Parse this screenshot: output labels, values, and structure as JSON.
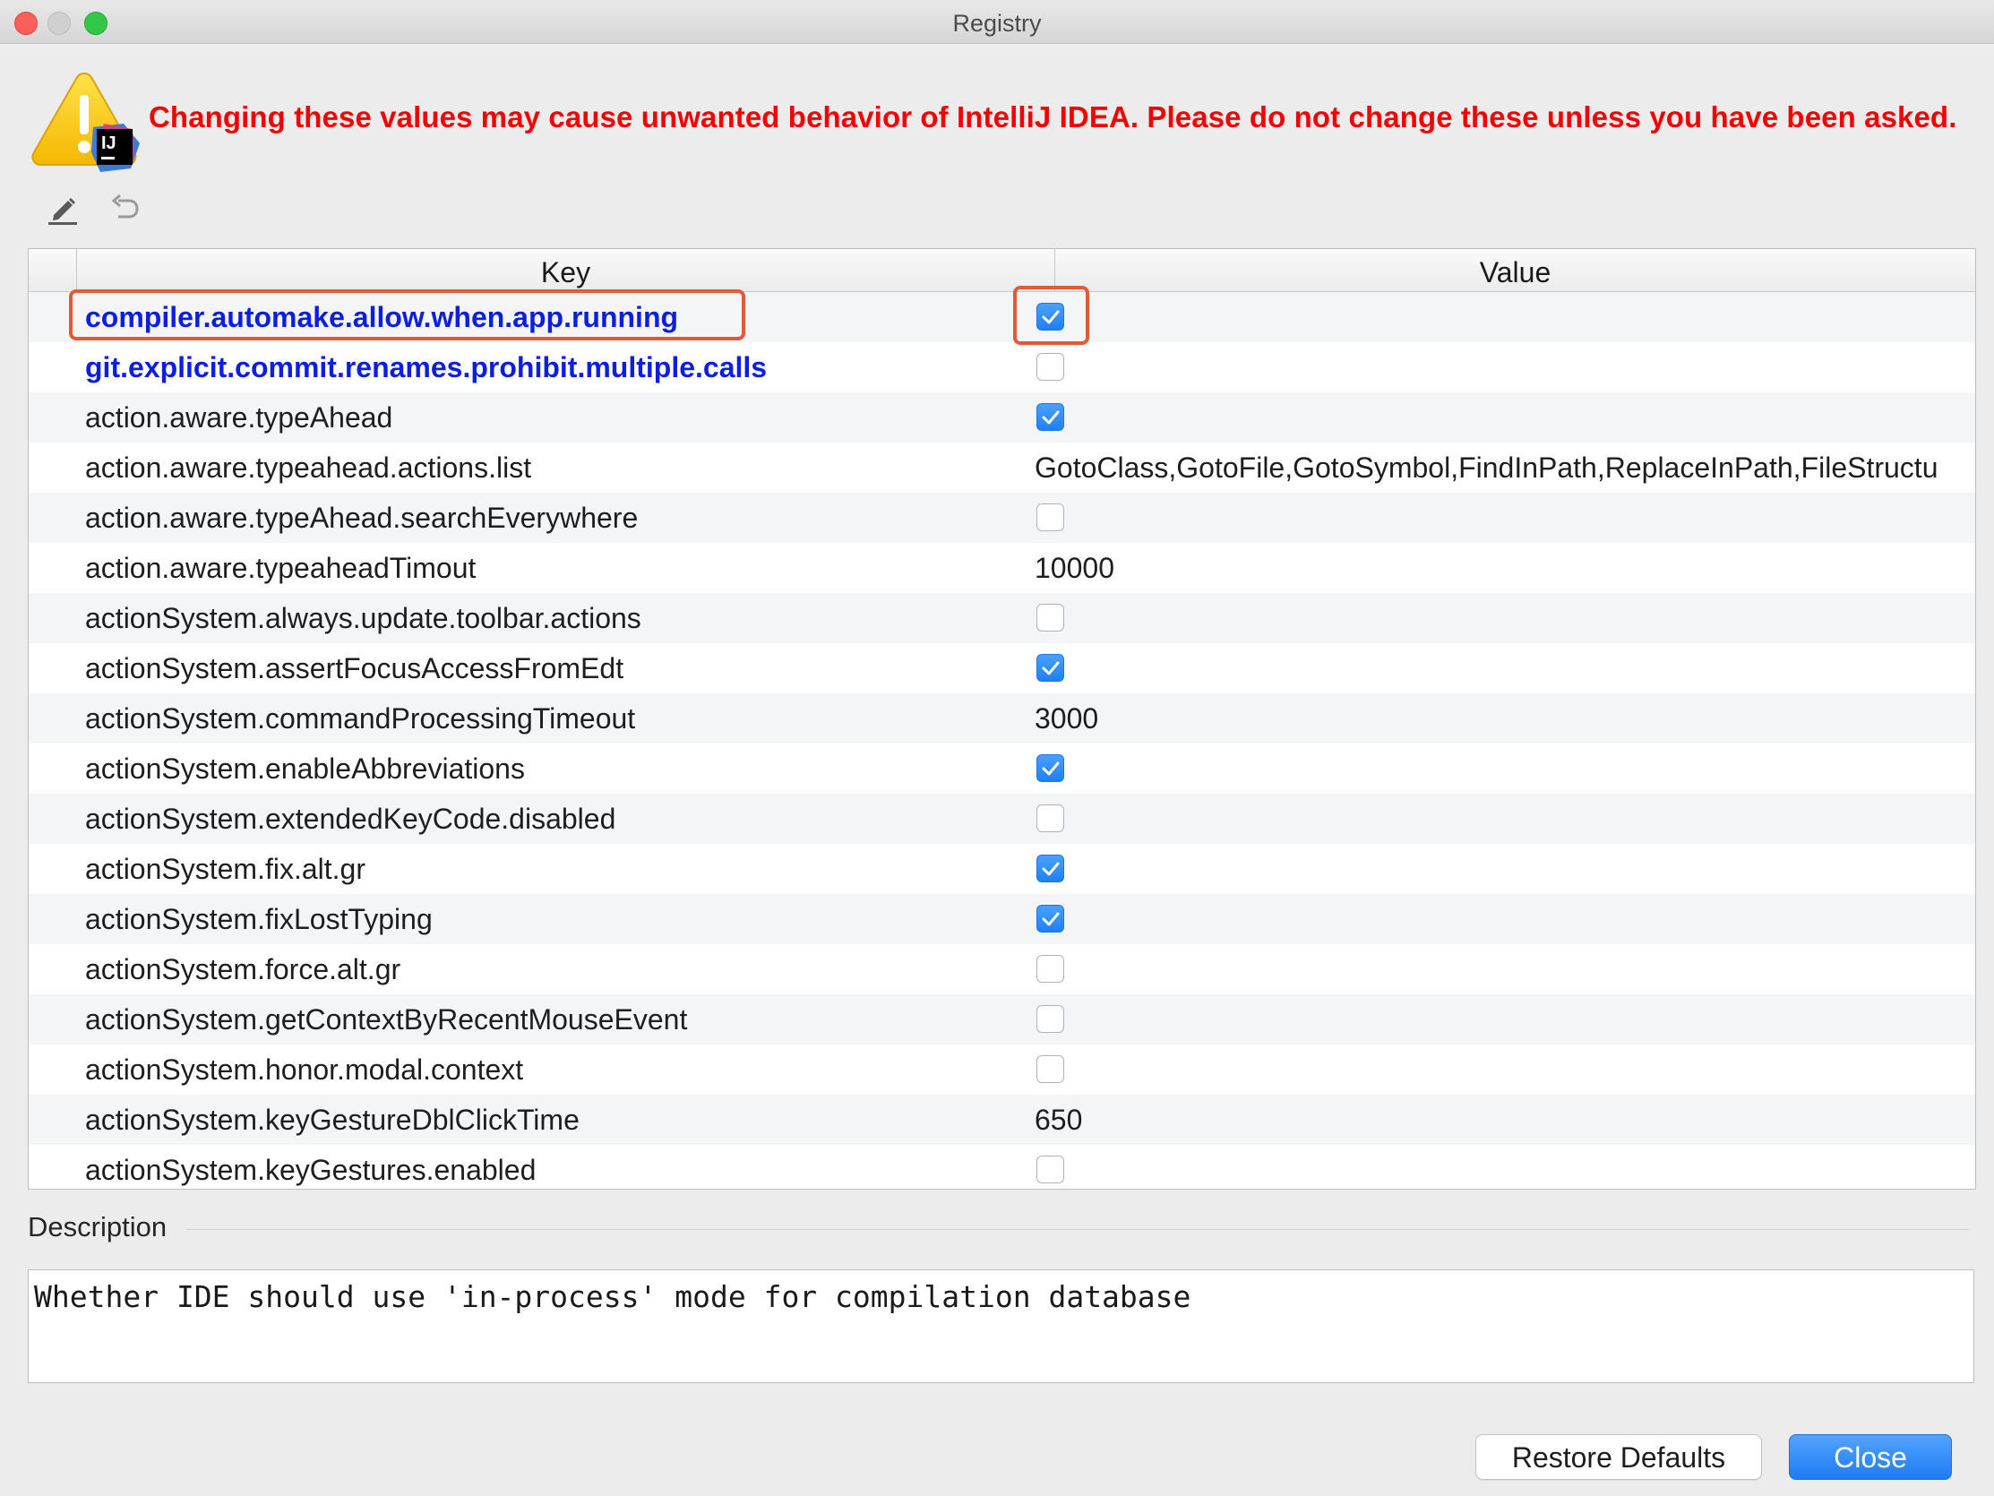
{
  "window": {
    "title": "Registry"
  },
  "header": {
    "warning": "Changing these values may cause unwanted behavior of IntelliJ IDEA. Please do not change these unless you have been asked.",
    "logo_text": "IJ"
  },
  "toolbar": {
    "edit_icon": "pencil-icon",
    "revert_icon": "undo-icon"
  },
  "table": {
    "columns": [
      "Key",
      "Value"
    ],
    "rows": [
      {
        "key": "compiler.automake.allow.when.app.running",
        "type": "bool",
        "value": true,
        "modified": true
      },
      {
        "key": "git.explicit.commit.renames.prohibit.multiple.calls",
        "type": "bool",
        "value": false,
        "modified": true
      },
      {
        "key": "action.aware.typeAhead",
        "type": "bool",
        "value": true,
        "modified": false
      },
      {
        "key": "action.aware.typeahead.actions.list",
        "type": "text",
        "value": "GotoClass,GotoFile,GotoSymbol,FindInPath,ReplaceInPath,FileStructu",
        "modified": false
      },
      {
        "key": "action.aware.typeAhead.searchEverywhere",
        "type": "bool",
        "value": false,
        "modified": false
      },
      {
        "key": "action.aware.typeaheadTimout",
        "type": "text",
        "value": "10000",
        "modified": false
      },
      {
        "key": "actionSystem.always.update.toolbar.actions",
        "type": "bool",
        "value": false,
        "modified": false
      },
      {
        "key": "actionSystem.assertFocusAccessFromEdt",
        "type": "bool",
        "value": true,
        "modified": false
      },
      {
        "key": "actionSystem.commandProcessingTimeout",
        "type": "text",
        "value": "3000",
        "modified": false
      },
      {
        "key": "actionSystem.enableAbbreviations",
        "type": "bool",
        "value": true,
        "modified": false
      },
      {
        "key": "actionSystem.extendedKeyCode.disabled",
        "type": "bool",
        "value": false,
        "modified": false
      },
      {
        "key": "actionSystem.fix.alt.gr",
        "type": "bool",
        "value": true,
        "modified": false
      },
      {
        "key": "actionSystem.fixLostTyping",
        "type": "bool",
        "value": true,
        "modified": false
      },
      {
        "key": "actionSystem.force.alt.gr",
        "type": "bool",
        "value": false,
        "modified": false
      },
      {
        "key": "actionSystem.getContextByRecentMouseEvent",
        "type": "bool",
        "value": false,
        "modified": false
      },
      {
        "key": "actionSystem.honor.modal.context",
        "type": "bool",
        "value": false,
        "modified": false
      },
      {
        "key": "actionSystem.keyGestureDblClickTime",
        "type": "text",
        "value": "650",
        "modified": false
      },
      {
        "key": "actionSystem.keyGestures.enabled",
        "type": "bool",
        "value": false,
        "modified": false
      }
    ]
  },
  "description": {
    "label": "Description",
    "text": "Whether IDE should use 'in-process' mode for compilation database"
  },
  "buttons": {
    "restore_defaults": "Restore Defaults",
    "close": "Close"
  },
  "colors": {
    "warning": "#f30000",
    "modified_key": "#0c1fe0",
    "highlight": "#e25a36",
    "accent": "#1f7ff5"
  }
}
